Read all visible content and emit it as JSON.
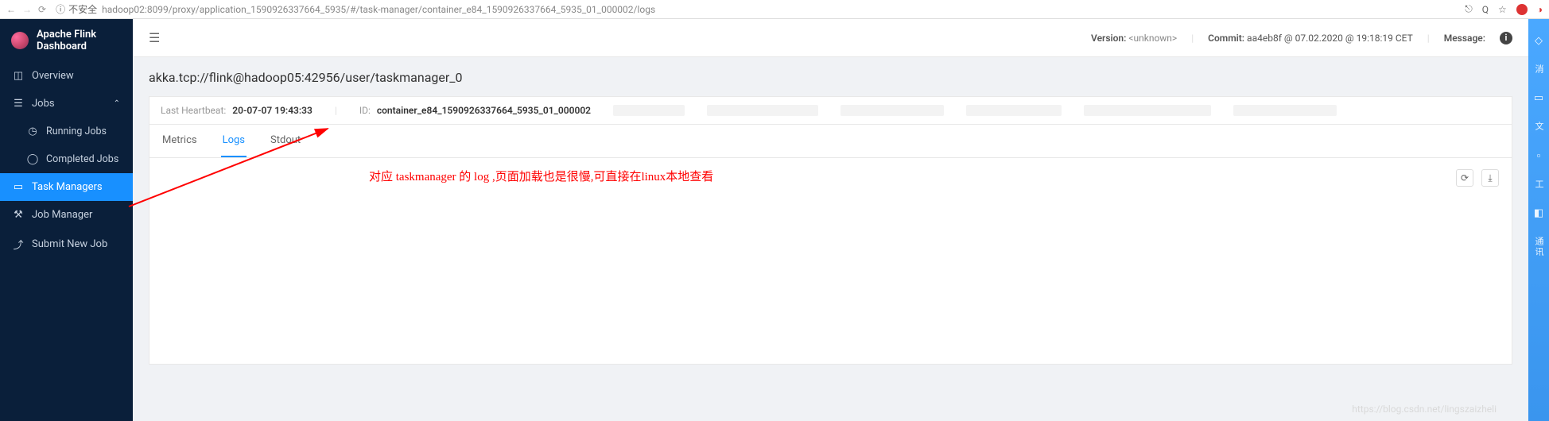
{
  "browser": {
    "insecure_label": "不安全",
    "url": "hadoop02:8099/proxy/application_1590926337664_5935/#/task-manager/container_e84_1590926337664_5935_01_000002/logs"
  },
  "header": {
    "title": "Apache Flink Dashboard"
  },
  "sidebar": {
    "overview": "Overview",
    "jobs": "Jobs",
    "running_jobs": "Running Jobs",
    "completed_jobs": "Completed Jobs",
    "task_managers": "Task Managers",
    "job_manager": "Job Manager",
    "submit_new_job": "Submit New Job"
  },
  "topbar": {
    "version_label": "Version:",
    "version_value": "<unknown>",
    "commit_label": "Commit:",
    "commit_value": "aa4eb8f @ 07.02.2020 @ 19:18:19 CET",
    "message_label": "Message:"
  },
  "page": {
    "title": "akka.tcp://flink@hadoop05:42956/user/taskmanager_0",
    "heartbeat_label": "Last Heartbeat:",
    "heartbeat_value": "20-07-07 19:43:33",
    "id_label": "ID:",
    "id_value": "container_e84_1590926337664_5935_01_000002"
  },
  "tabs": {
    "metrics": "Metrics",
    "logs": "Logs",
    "stdout": "Stdout"
  },
  "annotation": "对应 taskmanager 的 log ,页面加载也是很慢,可直接在linux本地查看",
  "edge": {
    "label1": "消",
    "label2": "文",
    "label3": "工",
    "label4": "通讯"
  },
  "watermark": "https://blog.csdn.net/lingszaizheli"
}
